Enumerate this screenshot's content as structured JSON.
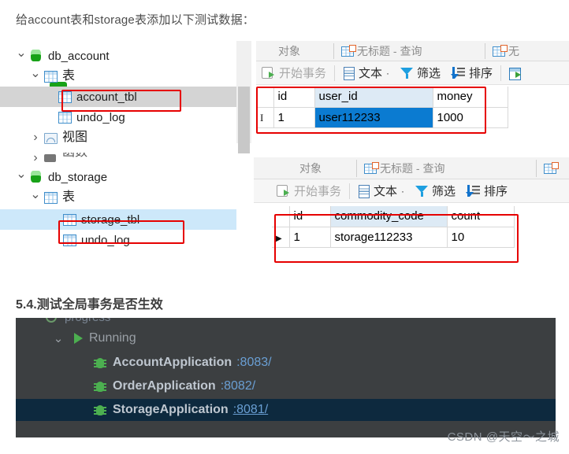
{
  "intro": {
    "text": "给account表和storage表添加以下测试数据："
  },
  "tree": {
    "nodes": [
      {
        "label": "db_account",
        "icon": "database-icon",
        "chevron": "down",
        "indent": 0,
        "selected": "none"
      },
      {
        "label": "表",
        "icon": "table-icon",
        "chevron": "down",
        "indent": 1,
        "selected": "none"
      },
      {
        "label": "account_tbl",
        "icon": "table-icon",
        "chevron": "none",
        "indent": 2,
        "selected": "grey"
      },
      {
        "label": "undo_log",
        "icon": "table-icon",
        "chevron": "none",
        "indent": 2,
        "selected": "none"
      },
      {
        "label": "视图",
        "icon": "view-icon",
        "chevron": "right",
        "indent": 1,
        "selected": "none"
      },
      {
        "label": "函数",
        "icon": "folder-icon",
        "chevron": "right",
        "indent": 1,
        "selected": "none"
      },
      {
        "label": "db_storage",
        "icon": "database-icon",
        "chevron": "down",
        "indent": 0,
        "selected": "none"
      },
      {
        "label": "表",
        "icon": "table-icon",
        "chevron": "down",
        "indent": 1,
        "selected": "none"
      },
      {
        "label": "storage_tbl",
        "icon": "table-icon",
        "chevron": "none",
        "indent": 2,
        "selected": "blue"
      },
      {
        "label": "undo_log",
        "icon": "table-icon",
        "chevron": "none",
        "indent": 2,
        "selected": "none"
      }
    ]
  },
  "grids": [
    {
      "tabs": [
        {
          "label": "对象",
          "icon": "none"
        },
        {
          "label": "无标题 - 查询",
          "icon": "query-grid-icon"
        },
        {
          "label": "无",
          "icon": "query-grid-icon"
        }
      ],
      "toolbar": [
        {
          "label": "开始事务",
          "icon": "begin-transaction-icon",
          "dim": true
        },
        {
          "label": "文本",
          "icon": "text-icon",
          "caret": "·"
        },
        {
          "label": "筛选",
          "icon": "filter-icon"
        },
        {
          "label": "排序",
          "icon": "sort-icon"
        },
        {
          "label": "",
          "icon": "grid-import-icon"
        }
      ],
      "columns": [
        "id",
        "user_id",
        "money"
      ],
      "highlight_column": "user_id",
      "rows": [
        {
          "gutter": "i-beam-cursor-icon",
          "id": "1",
          "user_id": "user112233",
          "money": "1000",
          "selected_cell": "user_id"
        }
      ]
    },
    {
      "tabs": [
        {
          "label": "对象",
          "icon": "none"
        },
        {
          "label": "无标题 - 查询",
          "icon": "query-grid-icon"
        },
        {
          "label": "",
          "icon": "query-grid-icon"
        }
      ],
      "toolbar": [
        {
          "label": "开始事务",
          "icon": "begin-transaction-icon",
          "dim": true
        },
        {
          "label": "文本",
          "icon": "text-icon",
          "caret": "·"
        },
        {
          "label": "筛选",
          "icon": "filter-icon"
        },
        {
          "label": "排序",
          "icon": "sort-icon"
        }
      ],
      "columns": [
        "id",
        "commodity_code",
        "count"
      ],
      "highlight_column": "commodity_code",
      "rows": [
        {
          "gutter": "row-caret-icon",
          "id": "1",
          "commodity_code": "storage112233",
          "count": "10",
          "selected_cell": "none"
        }
      ]
    }
  ],
  "section_heading": "5.4.测试全局事务是否生效",
  "services": {
    "clipped_row_label": "progress",
    "group": {
      "label": "Running",
      "chevron": "down",
      "icon": "play-icon"
    },
    "items": [
      {
        "name": "AccountApplication",
        "port": ":8083/",
        "icon": "spring-bug-icon",
        "selected": false,
        "underline": false
      },
      {
        "name": "OrderApplication",
        "port": ":8082/",
        "icon": "spring-bug-icon",
        "selected": false,
        "underline": false
      },
      {
        "name": "StorageApplication",
        "port": ":8081/",
        "icon": "spring-bug-icon",
        "selected": true,
        "underline": true
      }
    ]
  },
  "watermark": "CSDN @天空～之城",
  "colors": {
    "red_box": "#e60000",
    "selected_cell": "#0b7bd1",
    "tree_select_grey": "#d4d4d4",
    "tree_select_blue": "#cde8fa",
    "ide_background": "#3c3f41",
    "ide_selected_row": "#0d293e",
    "port_link": "#6a9fd4",
    "green": "#4caf50"
  }
}
